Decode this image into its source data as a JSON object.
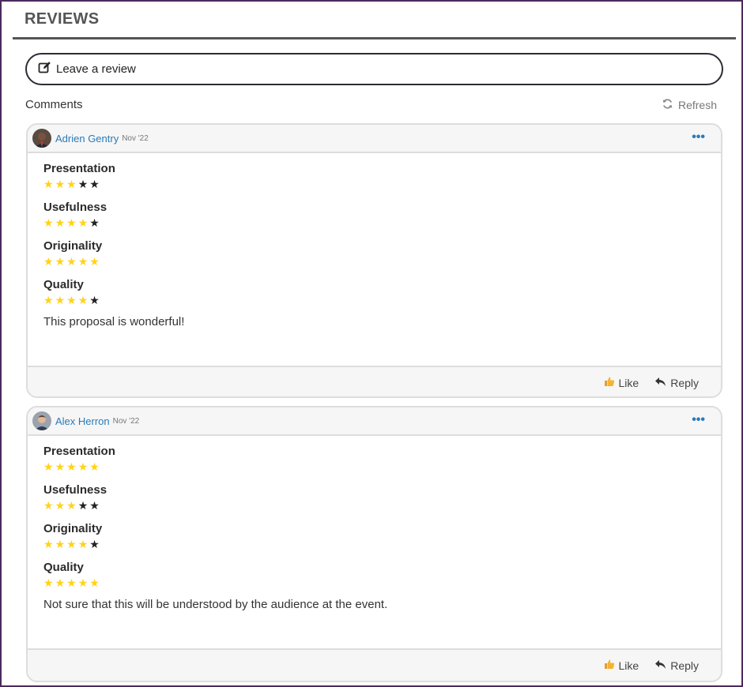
{
  "section": {
    "title": "REVIEWS"
  },
  "leave_review": {
    "label": "Leave a review",
    "icon": "edit-icon"
  },
  "comments": {
    "label": "Comments",
    "refresh_label": "Refresh",
    "refresh_icon": "refresh-icon"
  },
  "colors": {
    "star_filled": "#ffd31a",
    "star_empty": "#222222",
    "link": "#2a7ab8",
    "frame": "#4b2a5e"
  },
  "reviews": [
    {
      "author": "Adrien Gentry",
      "date": "Nov '22",
      "criteria": [
        {
          "name": "Presentation",
          "rating": 3,
          "max": 5
        },
        {
          "name": "Usefulness",
          "rating": 4,
          "max": 5
        },
        {
          "name": "Originality",
          "rating": 5,
          "max": 5
        },
        {
          "name": "Quality",
          "rating": 4,
          "max": 5
        }
      ],
      "text": "This proposal is wonderful!",
      "like_label": "Like",
      "reply_label": "Reply"
    },
    {
      "author": "Alex Herron",
      "date": "Nov '22",
      "criteria": [
        {
          "name": "Presentation",
          "rating": 5,
          "max": 5
        },
        {
          "name": "Usefulness",
          "rating": 3,
          "max": 5
        },
        {
          "name": "Originality",
          "rating": 4,
          "max": 5
        },
        {
          "name": "Quality",
          "rating": 5,
          "max": 5
        }
      ],
      "text": "Not sure that this will be understood by the audience at the event.",
      "like_label": "Like",
      "reply_label": "Reply"
    }
  ]
}
